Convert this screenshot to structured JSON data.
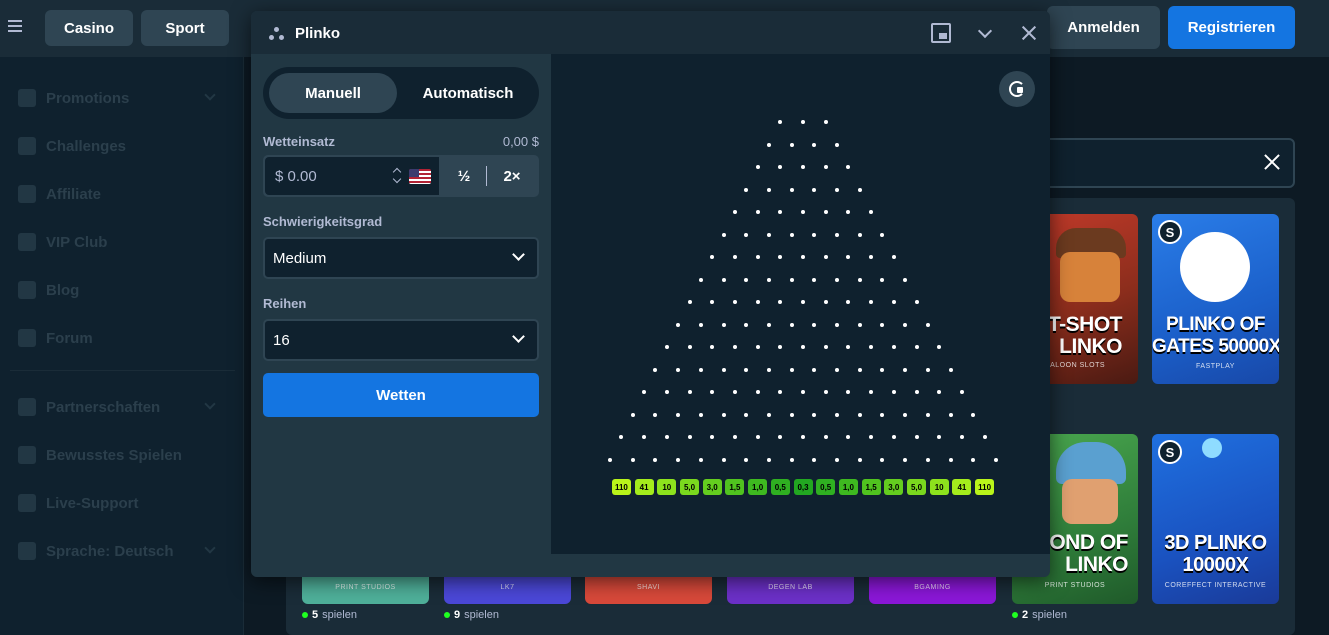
{
  "topbar": {
    "nav": [
      "Casino",
      "Sport"
    ],
    "login": "Anmelden",
    "register": "Registrieren"
  },
  "sidebar": {
    "items": [
      {
        "label": "Promotions",
        "icon": "gift-icon",
        "chevron": true
      },
      {
        "label": "Challenges",
        "icon": "trophy-icon",
        "chevron": false
      },
      {
        "label": "Affiliate",
        "icon": "users-icon",
        "chevron": false
      },
      {
        "label": "VIP Club",
        "icon": "crown-icon",
        "chevron": false
      },
      {
        "label": "Blog",
        "icon": "document-icon",
        "chevron": false
      },
      {
        "label": "Forum",
        "icon": "chat-icon",
        "chevron": false
      },
      {
        "label": "Partnerschaften",
        "icon": "handshake-icon",
        "chevron": true
      },
      {
        "label": "Bewusstes Spielen",
        "icon": "shield-icon",
        "chevron": false
      },
      {
        "label": "Live-Support",
        "icon": "headset-icon",
        "chevron": false
      },
      {
        "label": "Sprache: Deutsch",
        "icon": "globe-icon",
        "chevron": true
      }
    ]
  },
  "results": {
    "cards": [
      {
        "title": "T-SHOT\nLINKO",
        "studio": "SALOON SLOTS",
        "badge": ""
      },
      {
        "title": "PLINKO OF\nGATES 50000X",
        "studio": "FASTPLAY",
        "badge": "S"
      },
      {
        "title": "OND OF\nLINKO",
        "studio": "PRINT STUDIOS",
        "badge": ""
      },
      {
        "title": "3D PLINKO\n10000X",
        "studio": "COREFFECT INTERACTIVE",
        "badge": "S"
      }
    ],
    "bottom_studios": [
      "PRINT STUDIOS",
      "LK7",
      "SHAVI",
      "DEGEN LAB",
      "BGAMING"
    ],
    "plays": [
      {
        "count": "5",
        "suffix": "spielen"
      },
      {
        "count": "9",
        "suffix": "spielen"
      },
      {
        "count": "2",
        "suffix": "spielen"
      }
    ]
  },
  "modal": {
    "title": "Plinko",
    "mode_tabs": [
      "Manuell",
      "Automatisch"
    ],
    "active_tab": "Manuell",
    "bet": {
      "label": "Wetteinsatz",
      "balance": "0,00 $",
      "value": "$ 0.00",
      "half": "½",
      "double": "2×"
    },
    "difficulty": {
      "label": "Schwierigkeitsgrad",
      "value": "Medium"
    },
    "rows": {
      "label": "Reihen",
      "value": "16"
    },
    "submit": "Wetten",
    "multipliers": [
      "110",
      "41",
      "10",
      "5,0",
      "3,0",
      "1,5",
      "1,0",
      "0,5",
      "0,3",
      "0,5",
      "1,0",
      "1,5",
      "3,0",
      "5,0",
      "10",
      "41",
      "110"
    ],
    "multiplier_colors": [
      "#b9f41a",
      "#a4ec1c",
      "#8de21d",
      "#7ad81e",
      "#64cd1f",
      "#50c31f",
      "#3eb920",
      "#2fb021",
      "#22a821",
      "#2fb021",
      "#3eb920",
      "#50c31f",
      "#64cd1f",
      "#7ad81e",
      "#8de21d",
      "#a4ec1c",
      "#b9f41a"
    ]
  },
  "colors": {
    "accent": "#1475e1",
    "panel": "#213743",
    "dark": "#0f212e"
  }
}
